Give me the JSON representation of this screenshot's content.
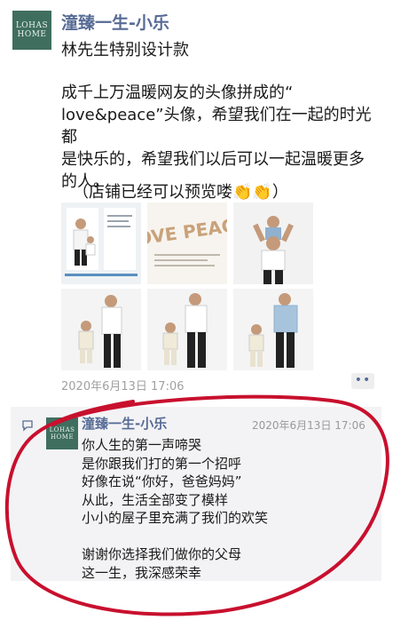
{
  "post": {
    "avatar_text": [
      "LOHAS",
      "HOME"
    ],
    "author": "潼臻一生-小乐",
    "subtitle": "林先生特别设计款",
    "body": "成千上万温暖网友的头像拼成的“\nlove&peace”头像，希望我们在一起的时光都\n是快乐的，希望我们以后可以一起温暖更多\n的人。",
    "preview_note": "（店铺已经可以预览喽👏👏）",
    "photo_text": "LOVE PEACE",
    "time": "2020年6月13日 17:06",
    "more_label": "••"
  },
  "comment": {
    "author": "潼臻一生-小乐",
    "time": "2020年6月13日 17:06",
    "lines": "你人生的第一声啼哭\n是你跟我们打的第一个招呼\n好像在说“你好，爸爸妈妈”\n从此，生活全部变了模样\n小小的屋子里充满了我们的欢笑\n\n谢谢你选择我们做你的父母\n这一生，我深感荣幸"
  },
  "colors": {
    "link": "#576b95",
    "avatar_bg": "#3f6e5f",
    "annotation": "#c8102e"
  }
}
